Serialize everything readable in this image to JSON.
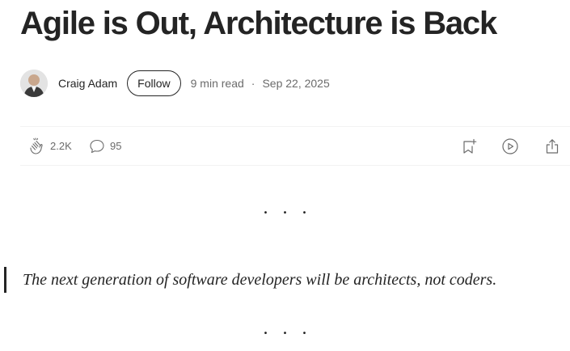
{
  "article": {
    "title": "Agile is Out, Architecture is Back",
    "author": "Craig Adam",
    "follow_label": "Follow",
    "read_time": "9 min read",
    "separator": "·",
    "date": "Sep 22, 2025",
    "quote": "The next generation of software developers will be architects, not coders.",
    "section_break": "...",
    "section_break_2": "..."
  },
  "actions": {
    "claps": "2.2K",
    "responses": "95",
    "icons": [
      "clap-icon",
      "comment-icon",
      "bookmark-add-icon",
      "play-icon",
      "share-icon"
    ]
  },
  "colors": {
    "text": "#242424",
    "muted": "#6b6b6b",
    "divider": "#f2f2f2"
  }
}
